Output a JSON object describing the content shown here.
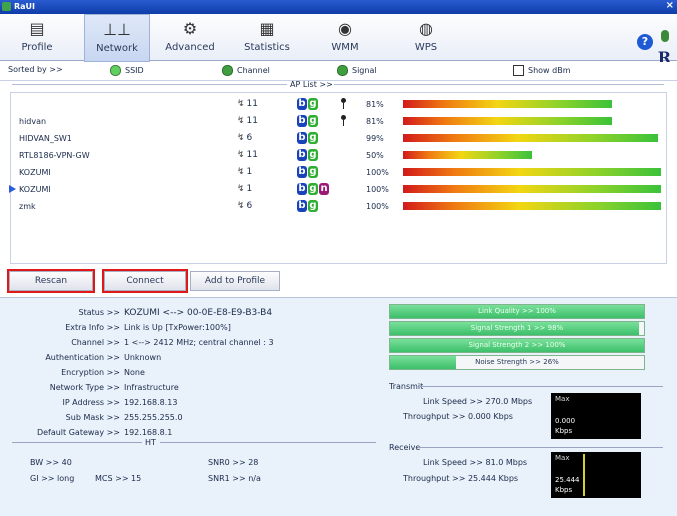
{
  "window": {
    "title": "RaUI",
    "close": "×"
  },
  "toolbar": {
    "items": [
      {
        "label": "Profile",
        "glyph": "▤"
      },
      {
        "label": "Network",
        "glyph": "⊥⊥"
      },
      {
        "label": "Advanced",
        "glyph": "⚙"
      },
      {
        "label": "Statistics",
        "glyph": "▦"
      },
      {
        "label": "WMM",
        "glyph": "◉"
      },
      {
        "label": "WPS",
        "glyph": "◍"
      }
    ],
    "help": "?",
    "logo": "R"
  },
  "sortbar": {
    "sorted_by": "Sorted by >>",
    "ssid": "SSID",
    "channel": "Channel",
    "signal": "Signal",
    "show_dbm": "Show dBm",
    "ap_list": "AP List >>"
  },
  "ap_list": [
    {
      "ssid": "",
      "channel": "11",
      "modes": [
        "b",
        "g"
      ],
      "secured": true,
      "signal": 81,
      "signal_text": "81%",
      "selected": false
    },
    {
      "ssid": "hidvan",
      "channel": "11",
      "modes": [
        "b",
        "g"
      ],
      "secured": true,
      "signal": 81,
      "signal_text": "81%",
      "selected": false
    },
    {
      "ssid": "HIDVAN_SW1",
      "channel": "6",
      "modes": [
        "b",
        "g"
      ],
      "secured": false,
      "signal": 99,
      "signal_text": "99%",
      "selected": false
    },
    {
      "ssid": "RTL8186-VPN-GW",
      "channel": "11",
      "modes": [
        "b",
        "g"
      ],
      "secured": false,
      "signal": 50,
      "signal_text": "50%",
      "selected": false
    },
    {
      "ssid": "KOZUMI",
      "channel": "1",
      "modes": [
        "b",
        "g"
      ],
      "secured": false,
      "signal": 100,
      "signal_text": "100%",
      "selected": false
    },
    {
      "ssid": "KOZUMI",
      "channel": "1",
      "modes": [
        "b",
        "g",
        "n"
      ],
      "secured": false,
      "signal": 100,
      "signal_text": "100%",
      "selected": true
    },
    {
      "ssid": "zmk",
      "channel": "6",
      "modes": [
        "b",
        "g"
      ],
      "secured": false,
      "signal": 100,
      "signal_text": "100%",
      "selected": false
    }
  ],
  "buttons": {
    "rescan": "Rescan",
    "connect": "Connect",
    "add_to_profile": "Add to Profile"
  },
  "info": [
    {
      "key": "Status >>",
      "value": "KOZUMI <--> 00-0E-E8-E9-B3-B4"
    },
    {
      "key": "Extra Info >>",
      "value": "Link is Up [TxPower:100%]"
    },
    {
      "key": "Channel >>",
      "value": "1 <--> 2412 MHz; central channel : 3"
    },
    {
      "key": "Authentication >>",
      "value": "Unknown"
    },
    {
      "key": "Encryption >>",
      "value": "None"
    },
    {
      "key": "Network Type >>",
      "value": "Infrastructure"
    },
    {
      "key": "IP Address >>",
      "value": "192.168.8.13"
    },
    {
      "key": "Sub Mask >>",
      "value": "255.255.255.0"
    },
    {
      "key": "Default Gateway >>",
      "value": "192.168.8.1"
    }
  ],
  "ht": {
    "label": "HT",
    "bw": "BW >> 40",
    "gi": "GI >> long",
    "mcs": "MCS >> 15",
    "snr0": "SNR0 >> 28",
    "snr1": "SNR1 >> n/a"
  },
  "quality": [
    {
      "label": "Link Quality >> 100%",
      "value": 100
    },
    {
      "label": "Signal Strength 1 >> 98%",
      "value": 98
    },
    {
      "label": "Signal Strength 2 >> 100%",
      "value": 100
    },
    {
      "label": "Noise Strength >> 26%",
      "value": 26
    }
  ],
  "transmit": {
    "label": "Transmit",
    "link_speed": "Link Speed >> 270.0 Mbps",
    "throughput": "Throughput >> 0.000 Kbps",
    "graph_max": "Max",
    "graph_value": "0.000",
    "graph_unit": "Kbps"
  },
  "receive": {
    "label": "Receive",
    "link_speed": "Link Speed >> 81.0 Mbps",
    "throughput": "Throughput >> 25.444 Kbps",
    "graph_max": "Max",
    "graph_value": "25.444",
    "graph_unit": "Kbps"
  }
}
